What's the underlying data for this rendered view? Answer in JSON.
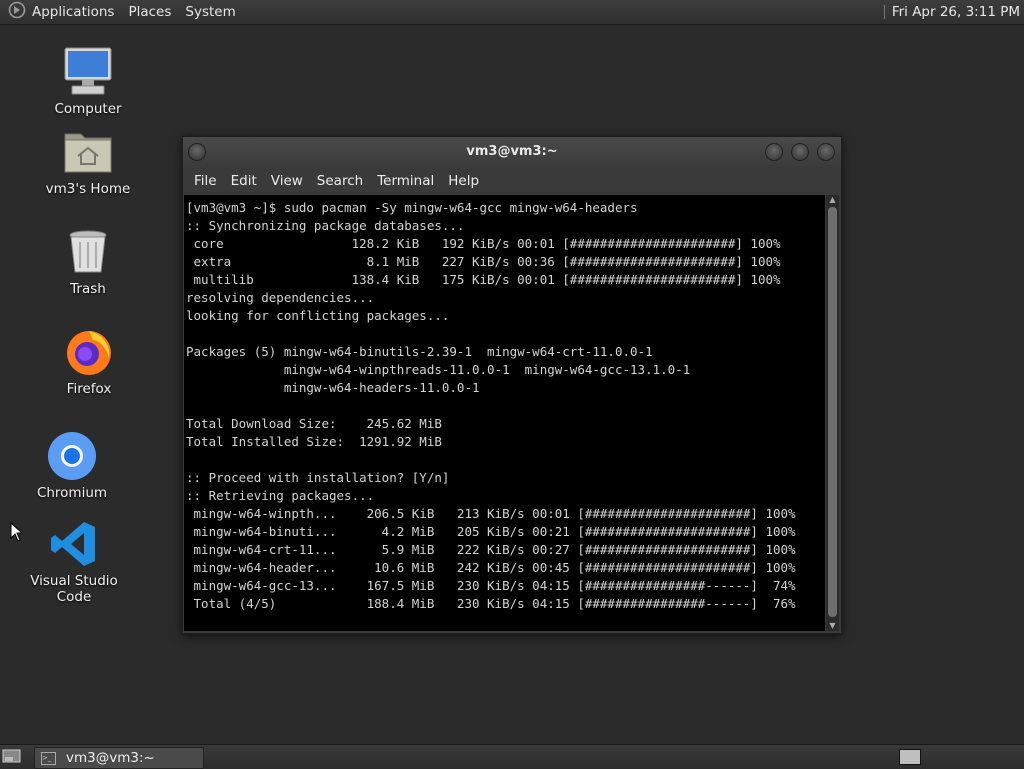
{
  "top_panel": {
    "menus": [
      "Applications",
      "Places",
      "System"
    ],
    "clock": "Fri Apr 26,  3:11 PM"
  },
  "desktop": {
    "icons": [
      {
        "label": "Computer",
        "icon": "computer-icon"
      },
      {
        "label": "vm3's Home",
        "icon": "home-folder-icon"
      },
      {
        "label": "Trash",
        "icon": "trash-icon"
      },
      {
        "label": "Firefox",
        "icon": "firefox-icon"
      },
      {
        "label": "Chromium",
        "icon": "chromium-icon"
      },
      {
        "label": "Visual Studio Code",
        "icon": "vscode-icon"
      }
    ]
  },
  "terminal": {
    "title": "vm3@vm3:~",
    "menu": [
      "File",
      "Edit",
      "View",
      "Search",
      "Terminal",
      "Help"
    ],
    "lines": [
      "[vm3@vm3 ~]$ sudo pacman -Sy mingw-w64-gcc mingw-w64-headers",
      ":: Synchronizing package databases...",
      " core                 128.2 KiB   192 KiB/s 00:01 [######################] 100%",
      " extra                  8.1 MiB   227 KiB/s 00:36 [######################] 100%",
      " multilib             138.4 KiB   175 KiB/s 00:01 [######################] 100%",
      "resolving dependencies...",
      "looking for conflicting packages...",
      "",
      "Packages (5) mingw-w64-binutils-2.39-1  mingw-w64-crt-11.0.0-1",
      "             mingw-w64-winpthreads-11.0.0-1  mingw-w64-gcc-13.1.0-1",
      "             mingw-w64-headers-11.0.0-1",
      "",
      "Total Download Size:    245.62 MiB",
      "Total Installed Size:  1291.92 MiB",
      "",
      ":: Proceed with installation? [Y/n]",
      ":: Retrieving packages...",
      " mingw-w64-winpth...    206.5 KiB   213 KiB/s 00:01 [######################] 100%",
      " mingw-w64-binuti...      4.2 MiB   205 KiB/s 00:21 [######################] 100%",
      " mingw-w64-crt-11...      5.9 MiB   222 KiB/s 00:27 [######################] 100%",
      " mingw-w64-header...     10.6 MiB   242 KiB/s 00:45 [######################] 100%",
      " mingw-w64-gcc-13...    167.5 MiB   230 KiB/s 04:15 [################------]  74%",
      " Total (4/5)            188.4 MiB   230 KiB/s 04:15 [################------]  76%"
    ]
  },
  "bottom_panel": {
    "task_label": "vm3@vm3:~"
  }
}
